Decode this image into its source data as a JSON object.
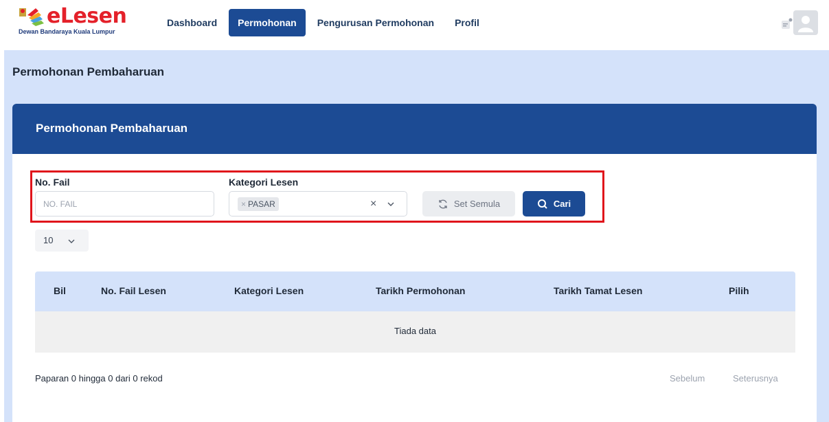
{
  "brand": {
    "name": "eLesen",
    "subtitle": "Dewan Bandaraya Kuala Lumpur"
  },
  "nav": {
    "items": [
      {
        "label": "Dashboard",
        "active": false
      },
      {
        "label": "Permohonan",
        "active": true
      },
      {
        "label": "Pengurusan Permohonan",
        "active": false
      },
      {
        "label": "Profil",
        "active": false
      }
    ]
  },
  "page": {
    "title": "Permohonan Pembaharuan"
  },
  "card": {
    "title": "Permohonan Pembaharuan"
  },
  "filters": {
    "file_no_label": "No. Fail",
    "file_no_placeholder": "NO. FAIL",
    "file_no_value": "",
    "category_label": "Kategori Lesen",
    "category_selected": "PASAR",
    "reset_label": "Set Semula",
    "search_label": "Cari"
  },
  "page_size": {
    "value": "10"
  },
  "table": {
    "columns": [
      "Bil",
      "No. Fail Lesen",
      "Kategori Lesen",
      "Tarikh Permohonan",
      "Tarikh Tamat Lesen",
      "Pilih"
    ],
    "rows": [],
    "empty_text": "Tiada data"
  },
  "pagination": {
    "info": "Paparan 0 hingga 0 dari 0 rekod",
    "prev_label": "Sebelum",
    "next_label": "Seterusnya"
  },
  "colors": {
    "primary": "#1c4b94",
    "page_bg": "#d4e2fa",
    "highlight": "#e0141b",
    "brand_red": "#e4212a"
  }
}
